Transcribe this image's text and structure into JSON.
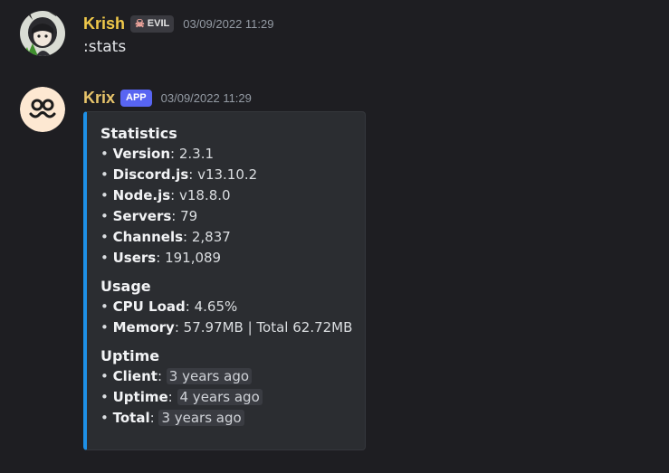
{
  "messages": [
    {
      "username": "Krish",
      "username_color": "#f0c94a",
      "tag": {
        "icon": "skull-icon",
        "label": "EVIL"
      },
      "timestamp": "03/09/2022 11:29",
      "content": ":stats"
    },
    {
      "username": "Krix",
      "username_color": "#e8c56b",
      "tag": {
        "label": "APP"
      },
      "timestamp": "03/09/2022 11:29",
      "embed": {
        "accent_color": "#1e90e6",
        "sections": [
          {
            "title": "Statistics",
            "rows": [
              {
                "key": "Version",
                "value": "2.3.1"
              },
              {
                "key": "Discord.js",
                "value": "v13.10.2"
              },
              {
                "key": "Node.js",
                "value": "v18.8.0"
              },
              {
                "key": "Servers",
                "value": "79"
              },
              {
                "key": "Channels",
                "value": "2,837"
              },
              {
                "key": "Users",
                "value": "191,089"
              }
            ]
          },
          {
            "title": "Usage",
            "rows": [
              {
                "key": "CPU Load",
                "value": "4.65%"
              },
              {
                "key": "Memory",
                "value": "57.97MB | Total 62.72MB"
              }
            ]
          },
          {
            "title": "Uptime",
            "rows": [
              {
                "key": "Client",
                "value": "3 years ago"
              },
              {
                "key": "Uptime",
                "value": "4 years ago"
              },
              {
                "key": "Total",
                "value": "3 years ago"
              }
            ]
          }
        ]
      }
    }
  ]
}
